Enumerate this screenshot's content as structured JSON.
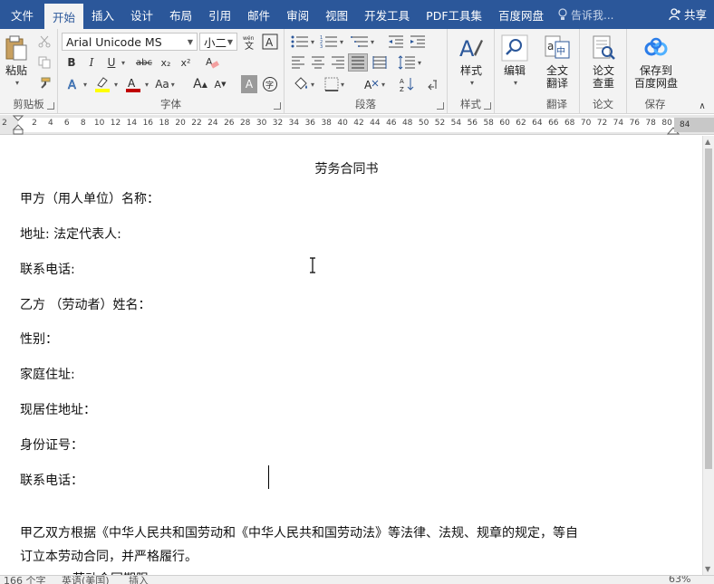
{
  "menu": {
    "tabs": [
      {
        "label": "文件",
        "active": false
      },
      {
        "label": "开始",
        "active": true
      },
      {
        "label": "插入",
        "active": false
      },
      {
        "label": "设计",
        "active": false
      },
      {
        "label": "布局",
        "active": false
      },
      {
        "label": "引用",
        "active": false
      },
      {
        "label": "邮件",
        "active": false
      },
      {
        "label": "审阅",
        "active": false
      },
      {
        "label": "视图",
        "active": false
      },
      {
        "label": "开发工具",
        "active": false
      },
      {
        "label": "PDF工具集",
        "active": false
      },
      {
        "label": "百度网盘",
        "active": false
      }
    ],
    "tell_me": "告诉我...",
    "share": "共享"
  },
  "ribbon": {
    "clipboard": {
      "paste": "粘贴",
      "label": "剪贴板"
    },
    "font": {
      "name": "Arial Unicode MS",
      "size": "小二",
      "label": "字体",
      "bold": "B",
      "italic": "I",
      "underline": "U",
      "strike": "abc",
      "sub": "x₂",
      "sup": "x²",
      "grow": "A",
      "shrink": "A",
      "case": "Aa",
      "shade": "A"
    },
    "paragraph": {
      "label": "段落"
    },
    "styles": {
      "btn": "样式",
      "label": "样式"
    },
    "editing": {
      "btn": "编辑"
    },
    "translate": {
      "btn": "全文\n翻译",
      "btn_l1": "全文",
      "btn_l2": "翻译",
      "label": "翻译"
    },
    "paper": {
      "btn_l1": "论文",
      "btn_l2": "查重",
      "label": "论文"
    },
    "save": {
      "btn_l1": "保存到",
      "btn_l2": "百度网盘",
      "label": "保存"
    }
  },
  "ruler": {
    "left_mark": "2",
    "numbers": [
      "2",
      "4",
      "6",
      "8",
      "10",
      "12",
      "14",
      "16",
      "18",
      "20",
      "22",
      "24",
      "26",
      "28",
      "30",
      "32",
      "34",
      "36",
      "38",
      "40",
      "42",
      "44",
      "46",
      "48",
      "50",
      "52",
      "54",
      "56",
      "58",
      "60",
      "62",
      "64",
      "66",
      "68",
      "70",
      "72",
      "74",
      "76",
      "78",
      "80"
    ],
    "end_mark": "84"
  },
  "document": {
    "title": "劳务合同书",
    "lines": [
      "甲方（用人单位）名称：",
      "地址: 法定代表人:",
      "联系电话:",
      "乙方 （劳动者）姓名：",
      "性别：",
      "家庭住址:",
      "现居住地址：",
      "身份证号：",
      "联系电话："
    ],
    "para1": "甲乙双方根据《中华人民共和国劳动和《中华人民共和国劳动法》等法律、法规、规章的规定，等自",
    "para2": "订立本劳动合同，并严格履行。",
    "para3": "一、劳动合同期限"
  },
  "status": {
    "words": "166 个字",
    "lang": "英语(美国)",
    "mode": "插入",
    "zoom": "63%"
  },
  "colors": {
    "accent": "#2b579a",
    "highlight": "#ffff00",
    "font_color": "#c00000"
  }
}
